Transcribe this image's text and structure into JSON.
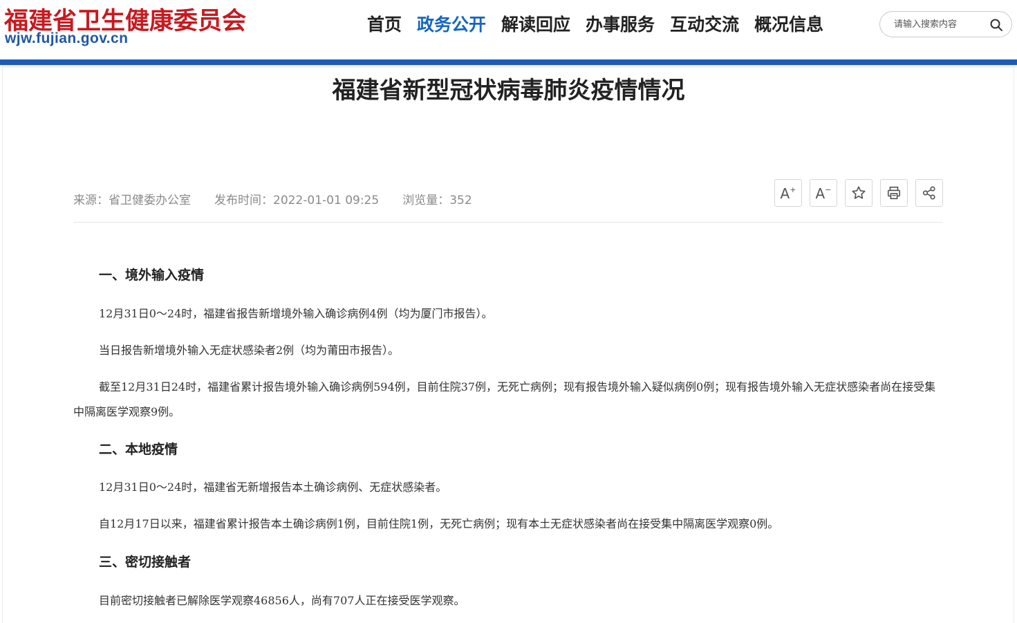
{
  "header": {
    "logo_cn": "福建省卫生健康委员会",
    "logo_en": "wjw.fujian.gov.cn",
    "nav": [
      {
        "label": "首页",
        "active": false
      },
      {
        "label": "政务公开",
        "active": true
      },
      {
        "label": "解读回应",
        "active": false
      },
      {
        "label": "办事服务",
        "active": false
      },
      {
        "label": "互动交流",
        "active": false
      },
      {
        "label": "概况信息",
        "active": false
      }
    ],
    "search": {
      "placeholder": "请输入搜索内容",
      "value": ""
    }
  },
  "colors": {
    "brand_red": "#c8191f",
    "brand_blue": "#1e5bb5",
    "nav_active": "#1565c0"
  },
  "article": {
    "title": "福建省新型冠状病毒肺炎疫情情况",
    "meta": {
      "source": "来源：省卫健委办公室",
      "publish_time": "发布时间：2022-01-01 09:25",
      "views": "浏览量：352"
    },
    "tools": [
      {
        "name": "font-increase-button",
        "icon": "font-increase-icon"
      },
      {
        "name": "font-decrease-button",
        "icon": "font-decrease-icon"
      },
      {
        "name": "favorite-button",
        "icon": "star-icon"
      },
      {
        "name": "print-button",
        "icon": "printer-icon"
      },
      {
        "name": "share-button",
        "icon": "share-icon"
      }
    ],
    "sections": [
      {
        "heading": "一、境外输入疫情",
        "paragraphs": [
          "12月31日0～24时，福建省报告新增境外输入确诊病例4例（均为厦门市报告）。",
          "当日报告新增境外输入无症状感染者2例（均为莆田市报告）。",
          "截至12月31日24时，福建省累计报告境外输入确诊病例594例，目前住院37例，无死亡病例；现有报告境外输入疑似病例0例；现有报告境外输入无症状感染者尚在接受集中隔离医学观察9例。"
        ]
      },
      {
        "heading": "二、本地疫情",
        "paragraphs": [
          "12月31日0～24时，福建省无新增报告本土确诊病例、无症状感染者。",
          "自12月17日以来，福建省累计报告本土确诊病例1例，目前住院1例，无死亡病例；现有本土无症状感染者尚在接受集中隔离医学观察0例。"
        ]
      },
      {
        "heading": "三、密切接触者",
        "paragraphs": [
          "目前密切接触者已解除医学观察46856人，尚有707人正在接受医学观察。"
        ]
      }
    ]
  }
}
